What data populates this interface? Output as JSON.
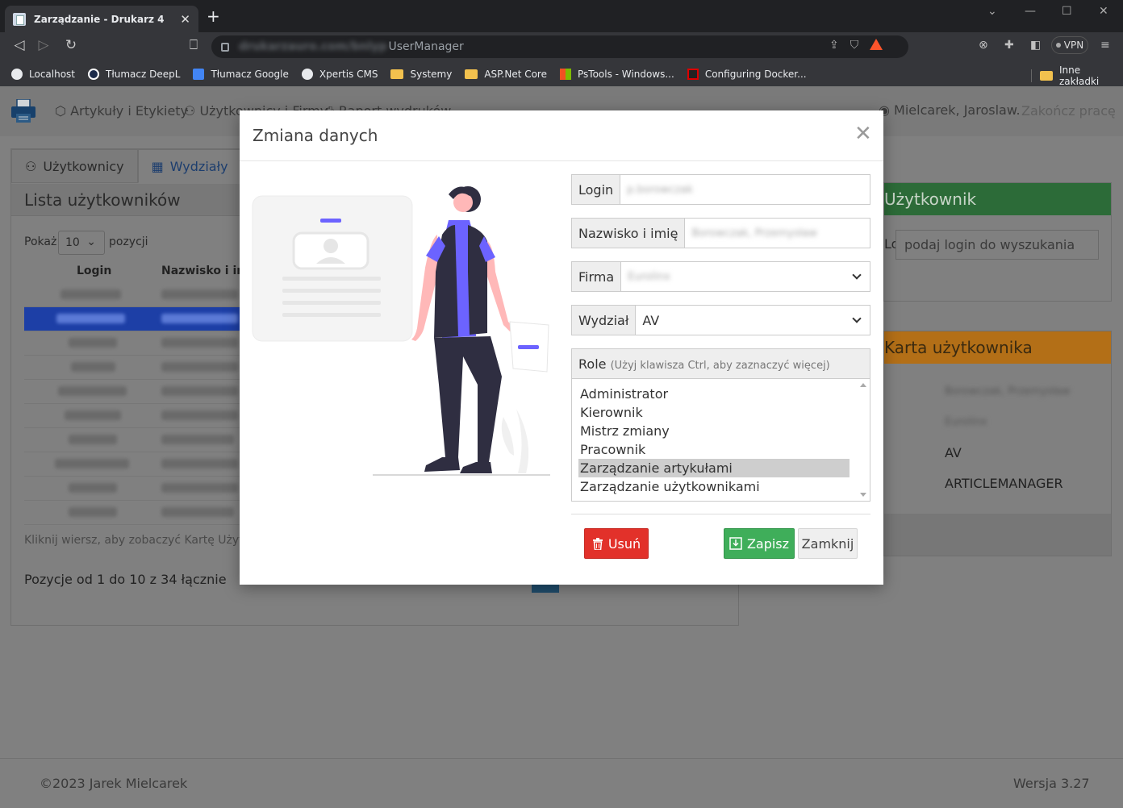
{
  "browser": {
    "tab_title": "Zarządzanie - Drukarz 4",
    "tab_close": "✕",
    "new_tab": "+",
    "url_host": "drukarzauro.com/bnlyp",
    "url_path": "UserManager",
    "vpn_label": "VPN",
    "bookmarks": [
      {
        "label": "Localhost",
        "icon": "globe-icon"
      },
      {
        "label": "Tłumacz DeepL",
        "icon": "deepl-icon"
      },
      {
        "label": "Tłumacz Google",
        "icon": "google-translate-icon"
      },
      {
        "label": "Xpertis CMS",
        "icon": "globe-icon"
      },
      {
        "label": "Systemy",
        "icon": "folder-icon"
      },
      {
        "label": "ASP.Net Core",
        "icon": "folder-icon"
      },
      {
        "label": "PsTools - Windows...",
        "icon": "microsoft-icon"
      },
      {
        "label": "Configuring Docker...",
        "icon": "docker-icon"
      }
    ],
    "other_bookmarks": "Inne zakładki"
  },
  "nav": {
    "articles": "Artykuły i Etykiety",
    "users": "Użytkownicy i Firmy",
    "report": "Raport wydruków",
    "user_name": "Mielcarek, Jaroslaw.",
    "logout": "Zakończ pracę"
  },
  "left_panel": {
    "tabs": [
      "Użytkownicy",
      "Wydziały"
    ],
    "title": "Lista użytkowników",
    "show_label": "Pokaż",
    "page_size": "10",
    "entries_label": "pozycji",
    "columns": [
      "Login",
      "Nazwisko i imię"
    ],
    "hint": "Kliknij wiersz, aby zobaczyć Kartę Użytkownika",
    "summary": "Pozycje od 1 do 10 z 34 łącznie"
  },
  "right_panel": {
    "search_title": "Użytkownik",
    "search_label": "Login",
    "search_placeholder": "podaj login do wyszukania",
    "card_title": "Karta użytkownika",
    "card_values": [
      "Borowczak, Przemysław",
      "Eurolinx",
      "AV",
      "ARTICLEMANAGER"
    ]
  },
  "footer": {
    "copyright": "©2023 Jarek Mielcarek",
    "version": "Wersja 3.27"
  },
  "modal": {
    "title": "Zmiana danych",
    "close_glyph": "✕",
    "login_label": "Login",
    "login_value": "p.borowczak",
    "name_label": "Nazwisko i imię",
    "name_value": "Borowczak, Przemysław",
    "company_label": "Firma",
    "company_value": "Eurolinx",
    "department_label": "Wydział",
    "department_value": "AV",
    "roles_label": "Role",
    "roles_hint": "(Użyj klawisza Ctrl, aby zaznaczyć więcej)",
    "roles": [
      "Administrator",
      "Kierownik",
      "Mistrz zmiany",
      "Pracownik",
      "Zarządzanie artykułami",
      "Zarządzanie użytkownikami"
    ],
    "selected_role": "Zarządzanie artykułami",
    "delete_label": "Usuń",
    "save_label": "Zapisz",
    "close_label": "Zamknij"
  },
  "colors": {
    "accent_blue": "#1d3fa6",
    "delete_red": "#e2312a",
    "save_green": "#3fae5a",
    "illustration_purple": "#6c63ff",
    "skin": "#ffb8b8"
  }
}
